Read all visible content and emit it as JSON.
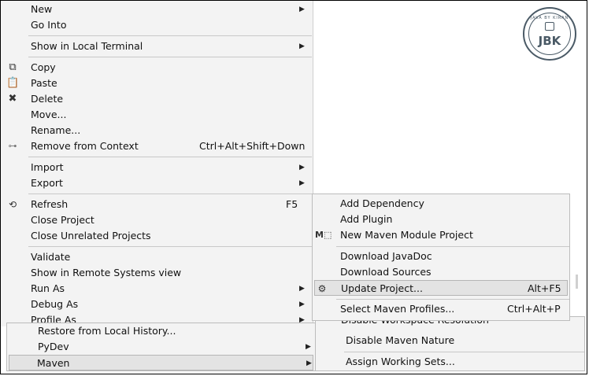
{
  "logo": {
    "text": "JBK",
    "ring_text": "JAVA BY KIRAN"
  },
  "context_menu": {
    "items": [
      {
        "label": "New",
        "arrow": true
      },
      {
        "label": "Go Into"
      },
      {
        "label": "Show in Local Terminal",
        "arrow": true
      },
      {
        "label": "Copy",
        "icon": "copy-icon"
      },
      {
        "label": "Paste",
        "icon": "paste-icon"
      },
      {
        "label": "Delete",
        "icon": "delete-icon"
      },
      {
        "label": "Move..."
      },
      {
        "label": "Rename..."
      },
      {
        "label": "Remove from Context",
        "shortcut": "Ctrl+Alt+Shift+Down",
        "icon": "remove-context-icon"
      },
      {
        "label": "Import",
        "arrow": true
      },
      {
        "label": "Export",
        "arrow": true
      },
      {
        "label": "Refresh",
        "shortcut": "F5",
        "icon": "refresh-icon"
      },
      {
        "label": "Close Project"
      },
      {
        "label": "Close Unrelated Projects"
      },
      {
        "label": "Validate"
      },
      {
        "label": "Show in Remote Systems view"
      },
      {
        "label": "Run As",
        "arrow": true
      },
      {
        "label": "Debug As",
        "arrow": true
      },
      {
        "label": "Profile As",
        "arrow": true
      }
    ]
  },
  "lower_menu": {
    "items": [
      {
        "label": "Restore from Local History..."
      },
      {
        "label": "PyDev",
        "arrow": true
      },
      {
        "label": "Maven",
        "arrow": true,
        "selected": true
      }
    ]
  },
  "maven_submenu": {
    "items": [
      {
        "label": "Add Dependency"
      },
      {
        "label": "Add Plugin"
      },
      {
        "label": "New Maven Module Project",
        "icon": "maven-module-icon"
      },
      {
        "label": "Download JavaDoc"
      },
      {
        "label": "Download Sources"
      },
      {
        "label": "Update Project...",
        "shortcut": "Alt+F5",
        "icon": "update-project-icon",
        "selected": true
      },
      {
        "label": "Select Maven Profiles...",
        "shortcut": "Ctrl+Alt+P"
      }
    ]
  },
  "lower_submenu": {
    "items": [
      {
        "label": "Disable Workspace Resolution"
      },
      {
        "label": "Disable Maven Nature"
      },
      {
        "label": "Assign Working Sets..."
      }
    ]
  }
}
